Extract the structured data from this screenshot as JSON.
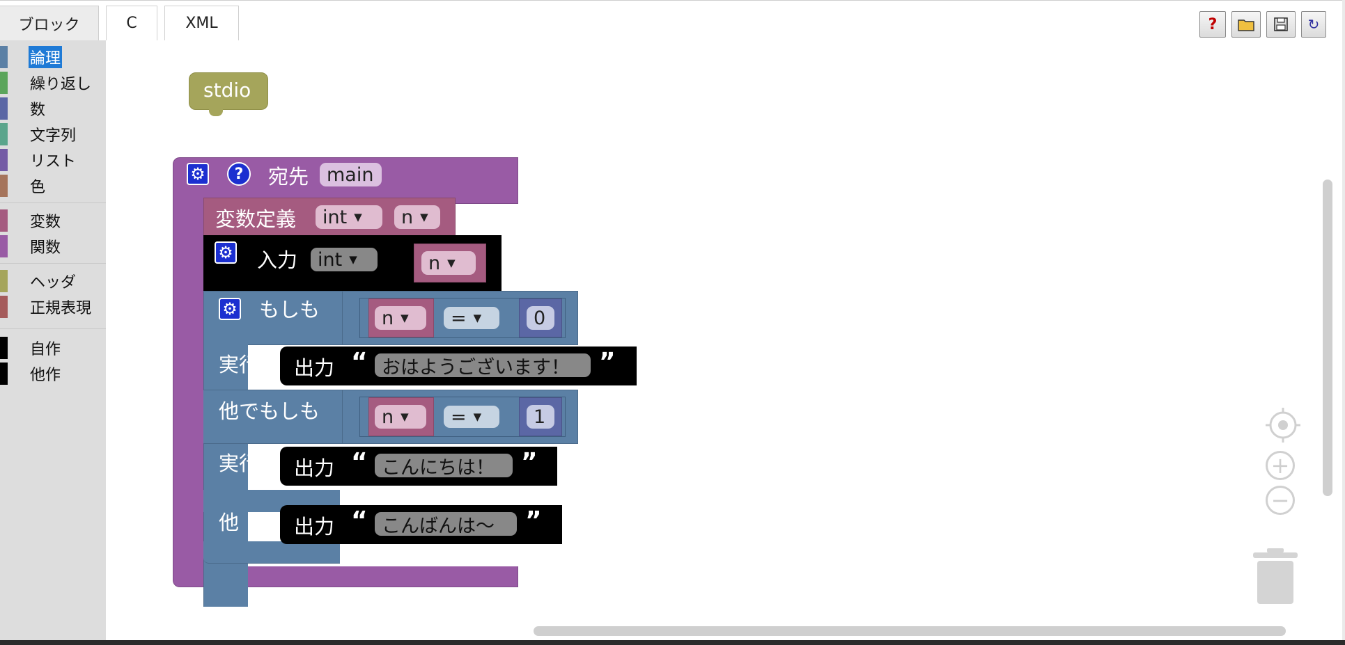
{
  "tabs": [
    {
      "label": "ブロック"
    },
    {
      "label": "C"
    },
    {
      "label": "XML"
    }
  ],
  "toolbar": {
    "help_icon": "?",
    "open_icon": "folder-icon",
    "save_icon": "save-icon",
    "refresh_icon": "↻"
  },
  "toolbox": {
    "categories": [
      {
        "label": "論理",
        "color": "#5b80a5",
        "selected": true
      },
      {
        "label": "繰り返し",
        "color": "#5ba55b"
      },
      {
        "label": "数",
        "color": "#5b67a5"
      },
      {
        "label": "文字列",
        "color": "#5ba58c"
      },
      {
        "label": "リスト",
        "color": "#745ba5"
      },
      {
        "label": "色",
        "color": "#a5745b"
      },
      {
        "label": "変数",
        "color": "#a55b80"
      },
      {
        "label": "関数",
        "color": "#995ba5"
      },
      {
        "label": "ヘッダ",
        "color": "#a5a55b"
      },
      {
        "label": "正規表現",
        "color": "#a55b5b"
      },
      {
        "label": "自作",
        "color": "#000000"
      },
      {
        "label": "他作",
        "color": "#000000"
      }
    ]
  },
  "blocks": {
    "header": {
      "label": "stdio",
      "color": "#a5a55b"
    },
    "function": {
      "label": "宛先",
      "name": "main",
      "color": "#995ba5"
    },
    "var_decl": {
      "label": "変数定義",
      "type": "int",
      "name": "n",
      "color": "#a55b80"
    },
    "input": {
      "label": "入力",
      "type": "int",
      "var": "n"
    },
    "if_block": {
      "if_label": "もしも",
      "do_label": "実行",
      "elseif_label": "他でもしも",
      "else_label": "他",
      "color": "#5b80a5",
      "cond1": {
        "var": "n",
        "op": "=",
        "value": "0"
      },
      "cond2": {
        "var": "n",
        "op": "=",
        "value": "1"
      }
    },
    "prints": [
      {
        "label": "出力",
        "text": "おはようございます！"
      },
      {
        "label": "出力",
        "text": "こんにちは！"
      },
      {
        "label": "出力",
        "text": "こんばんは～"
      }
    ],
    "quote_open": "“",
    "quote_close": "”"
  }
}
